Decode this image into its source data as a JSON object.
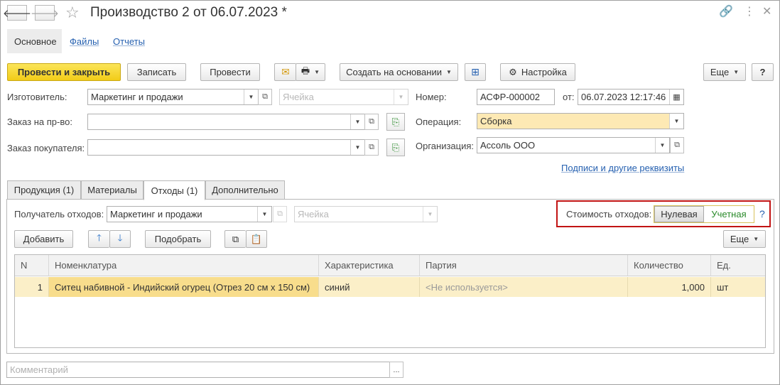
{
  "window": {
    "title": "Производство 2 от 06.07.2023 *",
    "icons": {
      "back": "arrow-left-icon",
      "forward": "arrow-right-icon",
      "favorite": "star-icon",
      "link": "link-icon",
      "menu": "more-vertical-icon",
      "close": "close-icon"
    }
  },
  "form_tabs": [
    "Основное",
    "Файлы",
    "Отчеты"
  ],
  "toolbar": {
    "post_and_close": "Провести и закрыть",
    "save": "Записать",
    "post": "Провести",
    "create_based_on": "Создать на основании",
    "settings": "Настройка",
    "more": "Еще",
    "help": "?"
  },
  "header": {
    "manufacturer": {
      "label": "Изготовитель:",
      "value": "Маркетинг и продажи",
      "cell_placeholder": "Ячейка"
    },
    "production_order": {
      "label": "Заказ на пр-во:",
      "value": ""
    },
    "customer_order": {
      "label": "Заказ покупателя:",
      "value": ""
    },
    "number": {
      "label": "Номер:",
      "value": "АСФР-000002",
      "date_label": "от:",
      "date_value": "06.07.2023 12:17:46"
    },
    "operation": {
      "label": "Операция:",
      "value": "Сборка"
    },
    "organization": {
      "label": "Организация:",
      "value": "Ассоль ООО"
    },
    "signatures_link": "Подписи и другие реквизиты"
  },
  "page_tabs": [
    "Продукция (1)",
    "Материалы",
    "Отходы (1)",
    "Дополнительно"
  ],
  "waste": {
    "recipient_label": "Получатель отходов:",
    "recipient_value": "Маркетинг и продажи",
    "cell_placeholder": "Ячейка",
    "cost_label": "Стоимость отходов:",
    "cost_options": [
      "Нулевая",
      "Учетная"
    ],
    "cost_help": "?",
    "add": "Добавить",
    "pick": "Подобрать",
    "more": "Еще"
  },
  "table": {
    "columns": [
      "N",
      "Номенклатура",
      "Характеристика",
      "Партия",
      "Количество",
      "Ед."
    ],
    "rows": [
      {
        "n": "1",
        "item": "Ситец набивной - Индийский огурец (Отрез 20 см х 150 см)",
        "characteristic": "синий",
        "batch": "<Не используется>",
        "quantity": "1,000",
        "unit": "шт"
      }
    ]
  },
  "comment": {
    "placeholder": "Комментарий",
    "button": "..."
  },
  "colors": {
    "primary": "#f5d22a",
    "highlight": "#fde9b4",
    "selected_row": "#fbefc8",
    "link": "#2560b0",
    "accent_green": "#2a8a2a",
    "callout_red": "#c21414"
  }
}
